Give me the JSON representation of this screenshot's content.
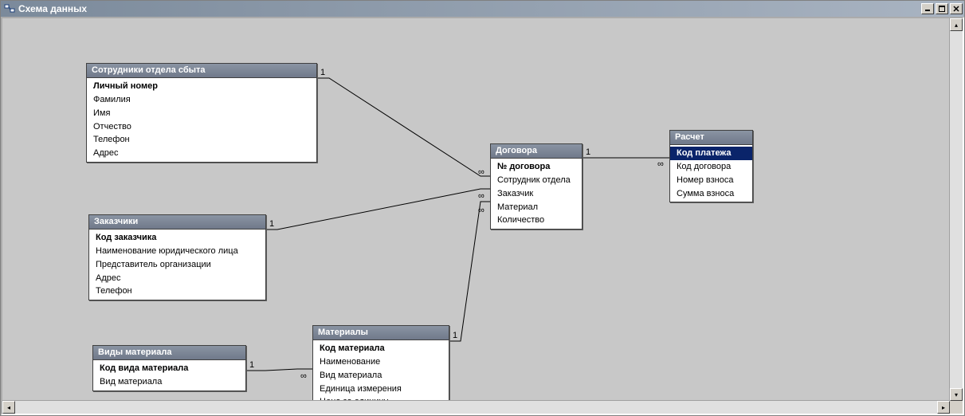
{
  "window": {
    "title": "Схема данных"
  },
  "tables": {
    "t_sales": {
      "title": "Сотрудники отдела сбыта",
      "fields": [
        {
          "label": "Личный номер",
          "pk": true
        },
        {
          "label": "Фамилия"
        },
        {
          "label": "Имя"
        },
        {
          "label": "Отчество"
        },
        {
          "label": "Телефон"
        },
        {
          "label": "Адрес"
        }
      ]
    },
    "t_customers": {
      "title": "Заказчики",
      "fields": [
        {
          "label": "Код заказчика",
          "pk": true
        },
        {
          "label": "Наименование юридического лица"
        },
        {
          "label": "Представитель организации"
        },
        {
          "label": "Адрес"
        },
        {
          "label": "Телефон"
        }
      ]
    },
    "t_mat_kinds": {
      "title": "Виды материала",
      "fields": [
        {
          "label": "Код вида материала",
          "pk": true
        },
        {
          "label": "Вид материала"
        }
      ]
    },
    "t_materials": {
      "title": "Материалы",
      "fields": [
        {
          "label": "Код материала",
          "pk": true
        },
        {
          "label": "Наименование"
        },
        {
          "label": "Вид материала"
        },
        {
          "label": "Единица измерения"
        },
        {
          "label": "Цена за единицу"
        }
      ]
    },
    "t_contracts": {
      "title": "Договора",
      "fields": [
        {
          "label": "№ договора",
          "pk": true
        },
        {
          "label": "Сотрудник отдела"
        },
        {
          "label": "Заказчик"
        },
        {
          "label": "Материал"
        },
        {
          "label": "Количество"
        }
      ]
    },
    "t_payment": {
      "title": "Расчет",
      "fields": [
        {
          "label": "Код платежа",
          "pk": true,
          "selected": true
        },
        {
          "label": "Код договора"
        },
        {
          "label": "Номер взноса"
        },
        {
          "label": "Сумма взноса"
        }
      ]
    }
  },
  "relations": [
    {
      "from": "t_sales",
      "to": "t_contracts",
      "card_from": "1",
      "card_to": "∞"
    },
    {
      "from": "t_customers",
      "to": "t_contracts",
      "card_from": "1",
      "card_to": "∞"
    },
    {
      "from": "t_materials",
      "to": "t_contracts",
      "card_from": "1",
      "card_to": "∞"
    },
    {
      "from": "t_mat_kinds",
      "to": "t_materials",
      "card_from": "1",
      "card_to": "∞"
    },
    {
      "from": "t_contracts",
      "to": "t_payment",
      "card_from": "1",
      "card_to": "∞"
    }
  ]
}
